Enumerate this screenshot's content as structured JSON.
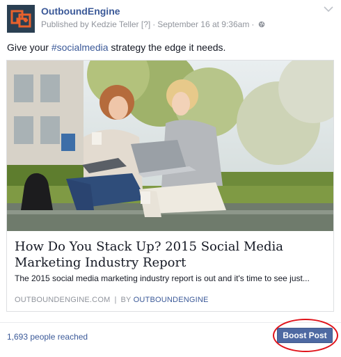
{
  "post": {
    "page_name": "OutboundEngine",
    "published_prefix": "Published by",
    "publisher": "Kedzie Teller",
    "help_marker": "[?]",
    "separator": "·",
    "timestamp": "September 16 at 9:36am",
    "audience_icon": "globe-icon",
    "menu_icon": "chevron-down-icon",
    "status_before": "Give your ",
    "hashtag": "#socialmedia",
    "status_after": " strategy the edge it needs."
  },
  "link_card": {
    "image_description_icon": "photo",
    "title": "How Do You Stack Up? 2015 Social Media Marketing Industry Report",
    "description": "The 2015 social media marketing industry report is out and it's time to see just...",
    "domain": "OUTBOUNDENGINE.COM",
    "bar": "|",
    "by_prefix": "BY",
    "by_name": "OUTBOUNDENGINE"
  },
  "footer": {
    "reach_text": "1,693 people reached",
    "boost_label": "Boost Post"
  },
  "colors": {
    "link_blue": "#3b5998",
    "button_blue": "#4e69a2",
    "highlight_red": "#e0131a",
    "logo_orange": "#e8612c",
    "logo_bg": "#2a3f52"
  }
}
